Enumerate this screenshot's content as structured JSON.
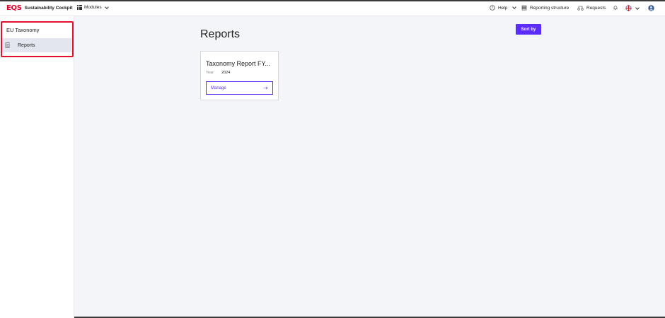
{
  "app": {
    "logo_mark": "EQS",
    "name": "Sustainability Cockpit",
    "modules_label": "Modules"
  },
  "header": {
    "help_label": "Help",
    "reporting_structure_label": "Reporting structure",
    "requests_label": "Requests",
    "icons": [
      "help-icon",
      "reporting-structure-icon",
      "requests-icon",
      "bell-icon",
      "uk-flag-icon",
      "avatar-icon"
    ]
  },
  "sidebar": {
    "title": "EU Taxonomy",
    "items": [
      {
        "label": "Reports",
        "icon": "document-icon",
        "active": true
      }
    ]
  },
  "main": {
    "title": "Reports",
    "sort_label": "Sort by",
    "cards": [
      {
        "title": "Taxonomy Report FY...",
        "year_label": "Year",
        "year_value": "2024",
        "manage_label": "Manage"
      }
    ]
  },
  "colors": {
    "brand_red": "#e0002a",
    "accent_purple": "#5b2dfa",
    "highlight_red": "#e0112b",
    "background": "#f4f5f9"
  }
}
